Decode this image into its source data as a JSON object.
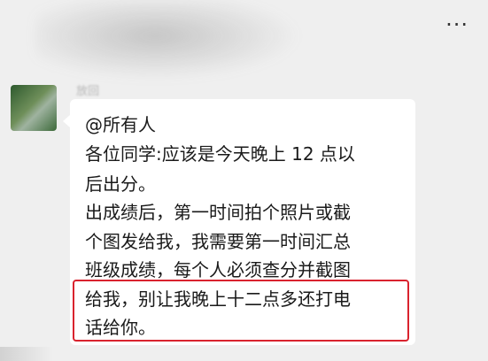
{
  "header": {
    "more_icon": "more-icon"
  },
  "sender": {
    "name": "放回"
  },
  "message": {
    "lines": [
      "@所有人",
      "各位同学:应该是今天晚上 12 点以",
      "后出分。",
      "出成绩后，第一时间拍个照片或截",
      "个图发给我，我需要第一时间汇总",
      "班级成绩，每个人必须查分并截图",
      "给我，别让我晚上十二点多还打电",
      "话给你。"
    ]
  },
  "highlight": {
    "color": "#d9232e"
  }
}
